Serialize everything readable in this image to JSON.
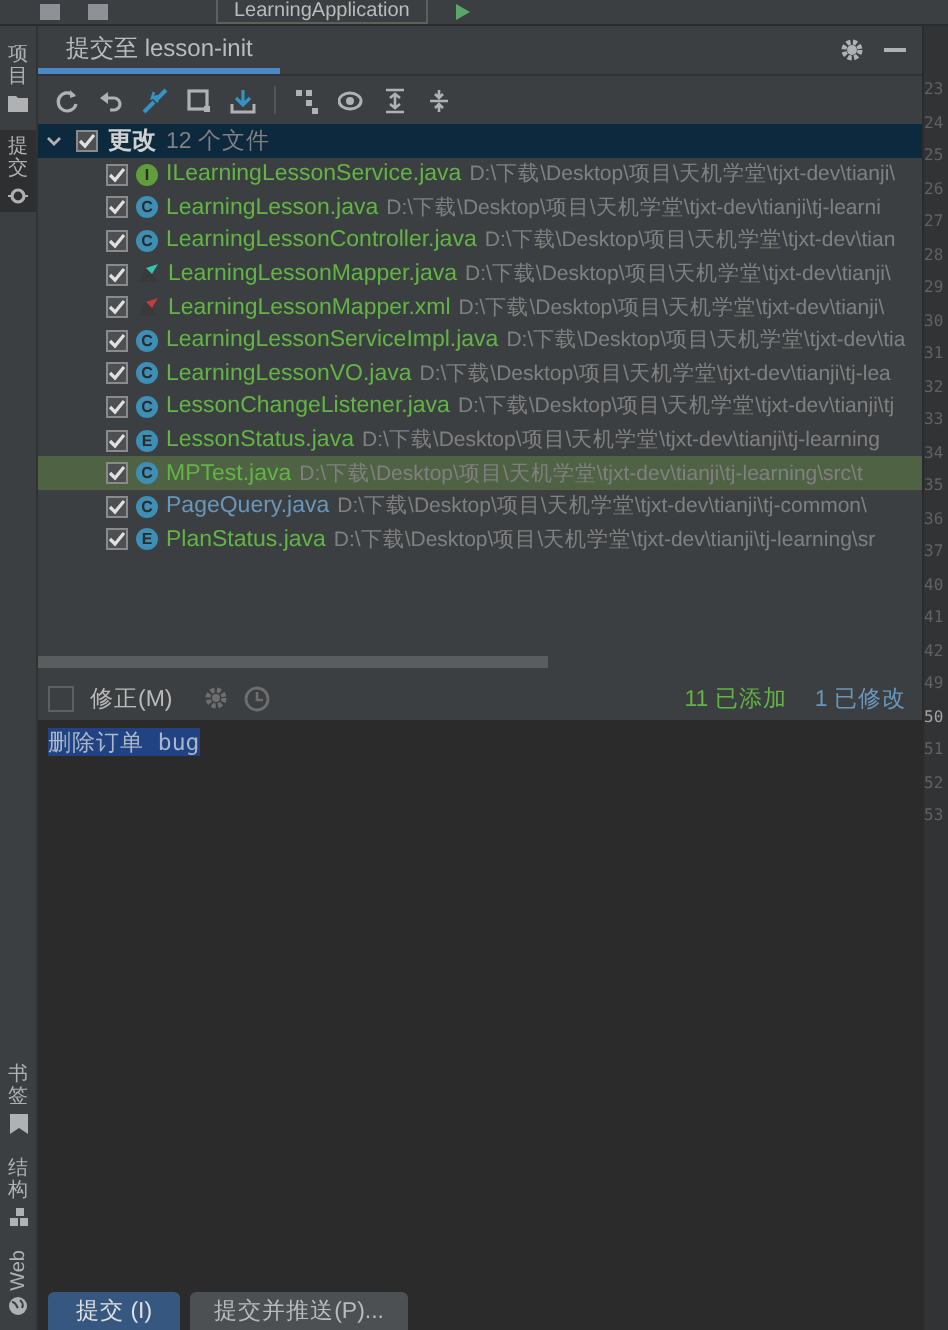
{
  "top_bar": {
    "run_config": "LearningApplication"
  },
  "side_tabs": [
    {
      "label": "项目",
      "selected": false
    },
    {
      "label": "提交",
      "selected": true
    }
  ],
  "side_tabs_bottom": [
    {
      "label": "书签",
      "selected": false
    },
    {
      "label": "结构",
      "selected": false
    },
    {
      "label": "Web",
      "selected": false
    }
  ],
  "panel": {
    "title": "提交至 lesson-init"
  },
  "changes": {
    "label": "更改",
    "count": "12 个文件",
    "expanded": true,
    "checked": true,
    "selected": true
  },
  "files": [
    {
      "kind": "interface",
      "badge": "I",
      "name": "ILearningLessonService.java",
      "path": "D:\\下载\\Desktop\\项目\\天机学堂\\tjxt-dev\\tianji\\",
      "color": "#62b543",
      "checked": true,
      "selected": false
    },
    {
      "kind": "class",
      "badge": "C",
      "name": "LearningLesson.java",
      "path": "D:\\下载\\Desktop\\项目\\天机学堂\\tjxt-dev\\tianji\\tj-learni",
      "color": "#62b543",
      "checked": true,
      "selected": false
    },
    {
      "kind": "class",
      "badge": "C",
      "name": "LearningLessonController.java",
      "path": "D:\\下载\\Desktop\\项目\\天机学堂\\tjxt-dev\\tian",
      "color": "#62b543",
      "checked": true,
      "selected": false
    },
    {
      "kind": "mapper",
      "name": "LearningLessonMapper.java",
      "path": "D:\\下载\\Desktop\\项目\\天机学堂\\tjxt-dev\\tianji\\",
      "color": "#62b543",
      "checked": true,
      "selected": false
    },
    {
      "kind": "xml",
      "name": "LearningLessonMapper.xml",
      "path": "D:\\下载\\Desktop\\项目\\天机学堂\\tjxt-dev\\tianji\\",
      "color": "#62b543",
      "checked": true,
      "selected": false
    },
    {
      "kind": "class",
      "badge": "C",
      "name": "LearningLessonServiceImpl.java",
      "path": "D:\\下载\\Desktop\\项目\\天机学堂\\tjxt-dev\\tia",
      "color": "#62b543",
      "checked": true,
      "selected": false
    },
    {
      "kind": "class",
      "badge": "C",
      "name": "LearningLessonVO.java",
      "path": "D:\\下载\\Desktop\\项目\\天机学堂\\tjxt-dev\\tianji\\tj-lea",
      "color": "#62b543",
      "checked": true,
      "selected": false
    },
    {
      "kind": "class",
      "badge": "C",
      "name": "LessonChangeListener.java",
      "path": "D:\\下载\\Desktop\\项目\\天机学堂\\tjxt-dev\\tianji\\tj",
      "color": "#62b543",
      "checked": true,
      "selected": false
    },
    {
      "kind": "enum",
      "badge": "E",
      "name": "LessonStatus.java",
      "path": "D:\\下载\\Desktop\\项目\\天机学堂\\tjxt-dev\\tianji\\tj-learning",
      "color": "#62b543",
      "checked": true,
      "selected": false
    },
    {
      "kind": "test",
      "badge": "C",
      "name": "MPTest.java",
      "path": "D:\\下载\\Desktop\\项目\\天机学堂\\tjxt-dev\\tianji\\tj-learning\\src\\t",
      "color": "#62b543",
      "checked": true,
      "selected": true
    },
    {
      "kind": "class",
      "badge": "C",
      "name": "PageQuery.java",
      "path": "D:\\下载\\Desktop\\项目\\天机学堂\\tjxt-dev\\tianji\\tj-common\\",
      "color": "#6897bb",
      "checked": true,
      "selected": false
    },
    {
      "kind": "enum",
      "badge": "E",
      "name": "PlanStatus.java",
      "path": "D:\\下载\\Desktop\\项目\\天机学堂\\tjxt-dev\\tianji\\tj-learning\\sr",
      "color": "#62b543",
      "checked": true,
      "selected": false
    }
  ],
  "amend": {
    "label": "修正(M)",
    "checked": false
  },
  "summary": {
    "added": "11 已添加",
    "modified": "1 已修改"
  },
  "message": {
    "value": "删除订单 bug",
    "selected": true
  },
  "buttons": [
    {
      "label": "提交 (I)",
      "primary": true
    },
    {
      "label": "提交并推送(P)...",
      "primary": false
    }
  ],
  "gutter": [
    {
      "number": "23",
      "current": false
    },
    {
      "number": "24",
      "current": false
    },
    {
      "number": "25",
      "current": false
    },
    {
      "number": "26",
      "current": false
    },
    {
      "number": "27",
      "current": false
    },
    {
      "number": "28",
      "current": false
    },
    {
      "number": "29",
      "current": false
    },
    {
      "number": "30",
      "current": false
    },
    {
      "number": "31",
      "current": false
    },
    {
      "number": "32",
      "current": false
    },
    {
      "number": "33",
      "current": false
    },
    {
      "number": "34",
      "current": false
    },
    {
      "number": "35",
      "current": false
    },
    {
      "number": "36",
      "current": false
    },
    {
      "number": "37",
      "current": false
    },
    {
      "number": "40",
      "current": false
    },
    {
      "number": "41",
      "current": false
    },
    {
      "number": "42",
      "current": false
    },
    {
      "number": "49",
      "current": false
    },
    {
      "number": "50",
      "current": true
    },
    {
      "number": "51",
      "current": false
    },
    {
      "number": "52",
      "current": false
    },
    {
      "number": "53",
      "current": false
    }
  ]
}
